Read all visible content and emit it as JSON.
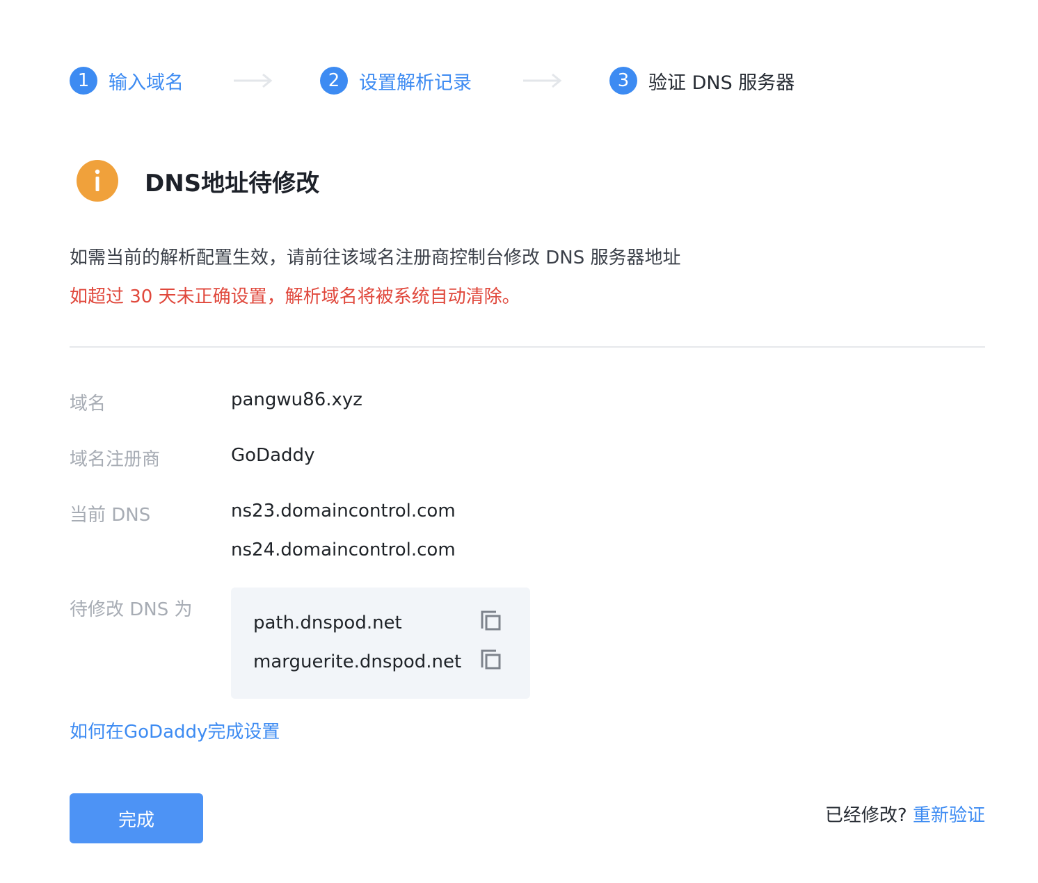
{
  "steps": [
    {
      "number": "1",
      "label": "输入域名"
    },
    {
      "number": "2",
      "label": "设置解析记录"
    },
    {
      "number": "3",
      "label": "验证 DNS 服务器"
    }
  ],
  "alert": {
    "icon": "info-icon",
    "title": "DNS地址待修改",
    "description": "如需当前的解析配置生效，请前往该域名注册商控制台修改 DNS 服务器地址",
    "warning": "如超过 30 天未正确设置，解析域名将被系统自动清除。"
  },
  "info": {
    "domain_label": "域名",
    "domain_value": "pangwu86.xyz",
    "registrar_label": "域名注册商",
    "registrar_value": "GoDaddy",
    "current_dns_label": "当前 DNS",
    "current_dns": [
      "ns23.domaincontrol.com",
      "ns24.domaincontrol.com"
    ],
    "target_dns_label": "待修改 DNS 为",
    "target_dns": [
      "path.dnspod.net",
      "marguerite.dnspod.net"
    ]
  },
  "help_link": "如何在GoDaddy完成设置",
  "done_button": "完成",
  "footer": {
    "question": "已经修改?",
    "reverify": "重新验证"
  },
  "colors": {
    "primary": "#3d8bf2",
    "button": "#4d93f5",
    "warning_icon": "#f0a13b",
    "warning_text": "#e0483c"
  }
}
